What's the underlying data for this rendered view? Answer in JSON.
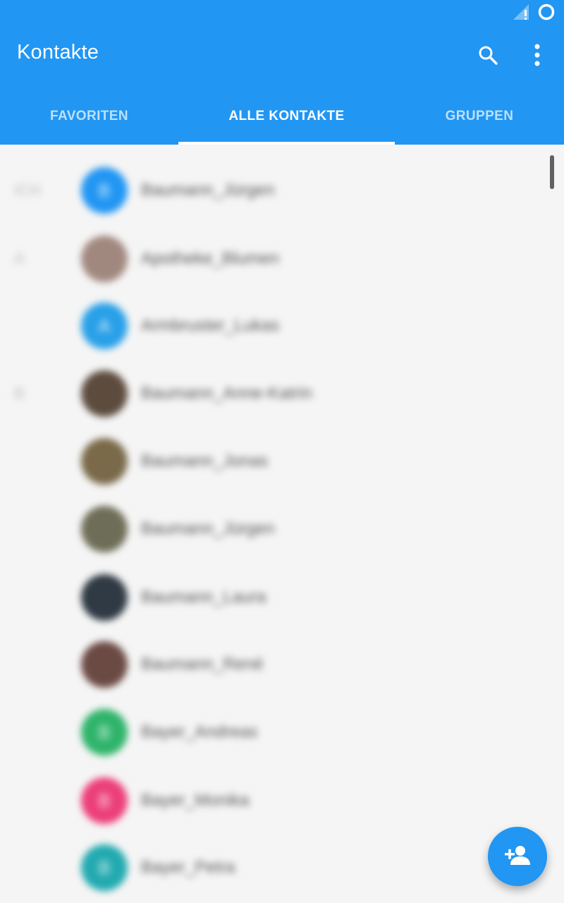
{
  "colors": {
    "app_bar": "#2196f3",
    "accent": "#2196f3",
    "background": "#f5f5f5"
  },
  "app": {
    "title": "Kontakte"
  },
  "actions": {
    "search_icon": "search-icon",
    "more_icon": "more-vert-icon"
  },
  "tabs": [
    {
      "label": "FAVORITEN",
      "selected": false
    },
    {
      "label": "ALLE KONTAKTE",
      "selected": true
    },
    {
      "label": "GRUPPEN",
      "selected": false
    }
  ],
  "contacts": [
    {
      "section": "ICH",
      "name": "Baumann_Jürgen",
      "avatar_letter": "B",
      "avatar_color": "#2196f3"
    },
    {
      "section": "A",
      "name": "Apotheke_Blumen",
      "avatar_letter": "",
      "avatar_color": "#a1887f"
    },
    {
      "section": "",
      "name": "Armbruster_Lukas",
      "avatar_letter": "A",
      "avatar_color": "#29a0e8"
    },
    {
      "section": "B",
      "name": "Baumann_Anne-Katrin",
      "avatar_letter": "",
      "avatar_color": "#5d4c3e"
    },
    {
      "section": "",
      "name": "Baumann_Jonas",
      "avatar_letter": "",
      "avatar_color": "#7a6a4a"
    },
    {
      "section": "",
      "name": "Baumann_Jürgen",
      "avatar_letter": "",
      "avatar_color": "#6e6e58"
    },
    {
      "section": "",
      "name": "Baumann_Laura",
      "avatar_letter": "",
      "avatar_color": "#2f3a44"
    },
    {
      "section": "",
      "name": "Baumann_René",
      "avatar_letter": "",
      "avatar_color": "#6b4a44"
    },
    {
      "section": "",
      "name": "Bayer_Andreas",
      "avatar_letter": "B",
      "avatar_color": "#2fb46a"
    },
    {
      "section": "",
      "name": "Bayer_Monika",
      "avatar_letter": "B",
      "avatar_color": "#ec3f7a"
    },
    {
      "section": "",
      "name": "Bayer_Petra",
      "avatar_letter": "B",
      "avatar_color": "#22aab0"
    }
  ],
  "fab": {
    "icon": "add-person-icon"
  },
  "status_bar": {
    "signal_icon": "no-signal-icon",
    "sync_icon": "sync-circle-icon"
  }
}
